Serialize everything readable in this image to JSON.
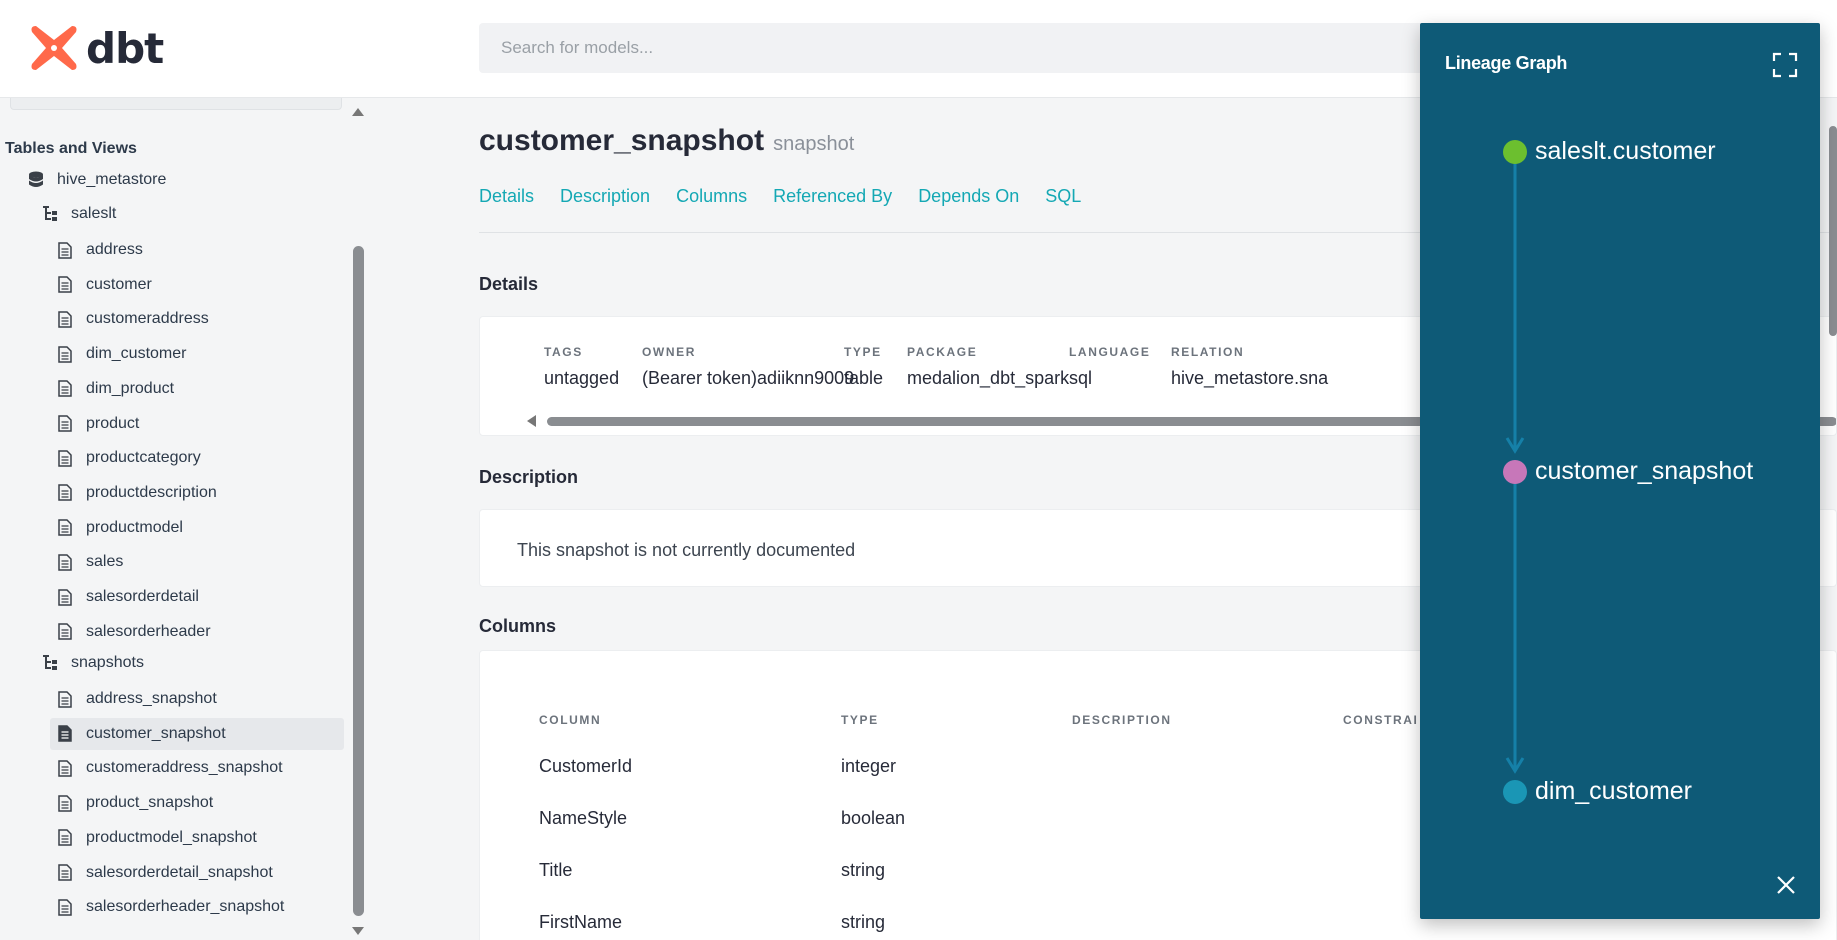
{
  "header": {
    "logo_text": "dbt",
    "search_placeholder": "Search for models..."
  },
  "sidebar": {
    "section_title": "Tables and Views",
    "database": "hive_metastore",
    "schemas": [
      {
        "name": "saleslt",
        "items": [
          "address",
          "customer",
          "customeraddress",
          "dim_customer",
          "dim_product",
          "product",
          "productcategory",
          "productdescription",
          "productmodel",
          "sales",
          "salesorderdetail",
          "salesorderheader"
        ]
      },
      {
        "name": "snapshots",
        "items": [
          "address_snapshot",
          "customer_snapshot",
          "customeraddress_snapshot",
          "product_snapshot",
          "productmodel_snapshot",
          "salesorderdetail_snapshot",
          "salesorderheader_snapshot"
        ]
      }
    ],
    "selected_item": "customer_snapshot"
  },
  "main": {
    "title": "customer_snapshot",
    "kind": "snapshot",
    "tabs": [
      "Details",
      "Description",
      "Columns",
      "Referenced By",
      "Depends On",
      "SQL"
    ],
    "details_title": "Details",
    "details": [
      {
        "label": "TAGS",
        "value": "untagged"
      },
      {
        "label": "OWNER",
        "value": "(Bearer token)adiiknn9009"
      },
      {
        "label": "TYPE",
        "value": "table"
      },
      {
        "label": "PACKAGE",
        "value": "medalion_dbt_spark"
      },
      {
        "label": "LANGUAGE",
        "value": "sql"
      },
      {
        "label": "RELATION",
        "value": "hive_metastore.sna"
      }
    ],
    "description_title": "Description",
    "description_text": "This snapshot is not currently documented",
    "columns_title": "Columns",
    "columns_headers": [
      "COLUMN",
      "TYPE",
      "DESCRIPTION",
      "CONSTRAI"
    ],
    "columns_rows": [
      {
        "column": "CustomerId",
        "type": "integer"
      },
      {
        "column": "NameStyle",
        "type": "boolean"
      },
      {
        "column": "Title",
        "type": "string"
      },
      {
        "column": "FirstName",
        "type": "string"
      }
    ]
  },
  "lineage": {
    "title": "Lineage Graph",
    "nodes": [
      {
        "label": "saleslt.customer",
        "color": "#6cbf2f"
      },
      {
        "label": "customer_snapshot",
        "color": "#c777b9"
      },
      {
        "label": "dim_customer",
        "color": "#1a96b5"
      }
    ],
    "panel_color": "#0e5a77",
    "edge_color": "#1580a8",
    "accent_color": "#14a8b4"
  }
}
